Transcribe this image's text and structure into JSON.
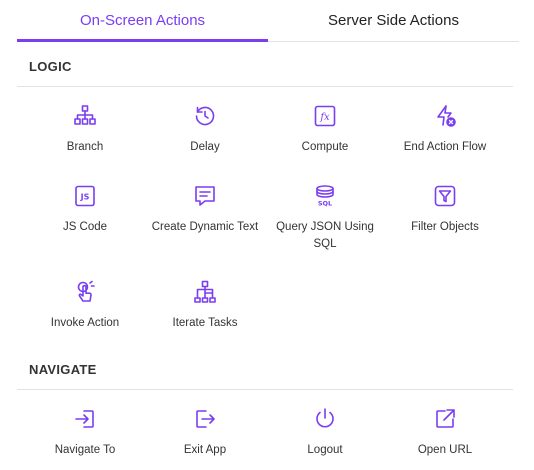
{
  "tabs": {
    "active": "On-Screen Actions",
    "inactive": "Server Side Actions"
  },
  "sections": {
    "logic": {
      "title": "LOGIC",
      "items": {
        "branch": "Branch",
        "delay": "Delay",
        "compute": "Compute",
        "end_action_flow": "End Action Flow",
        "js_code": "JS Code",
        "create_dynamic_text": "Create Dynamic Text",
        "query_json": "Query JSON Using SQL",
        "filter_objects": "Filter Objects",
        "invoke_action": "Invoke Action",
        "iterate_tasks": "Iterate Tasks"
      }
    },
    "navigate": {
      "title": "NAVIGATE",
      "items": {
        "navigate_to": "Navigate To",
        "exit_app": "Exit App",
        "logout": "Logout",
        "open_url": "Open URL"
      }
    }
  },
  "icon_glyphs": {
    "js": "JS",
    "fx": "fx",
    "sql": "SQL"
  },
  "colors": {
    "accent": "#7b3df0",
    "text": "#333333",
    "divider": "#e2e2e2"
  }
}
